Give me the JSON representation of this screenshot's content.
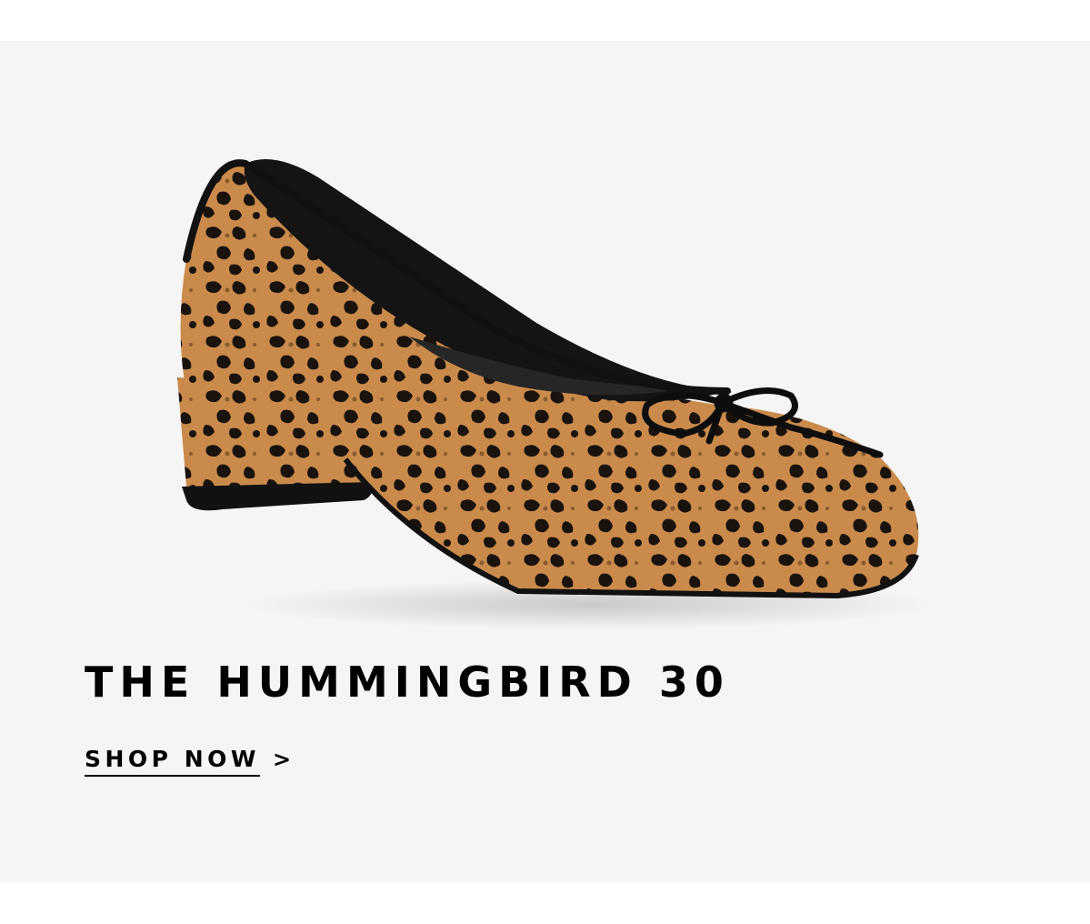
{
  "banner": {
    "title": "THE HUMMINGBIRD 30",
    "cta_label": "SHOP NOW",
    "cta_arrow": ">"
  },
  "colors": {
    "page_background": "#ffffff",
    "banner_background": "#f5f5f5",
    "text": "#000000",
    "leopard_base": "#c98a4b",
    "leopard_spot": "#1a120d",
    "shoe_trim": "#111111"
  },
  "icons": {
    "cta_arrow": "chevron-right-icon"
  }
}
